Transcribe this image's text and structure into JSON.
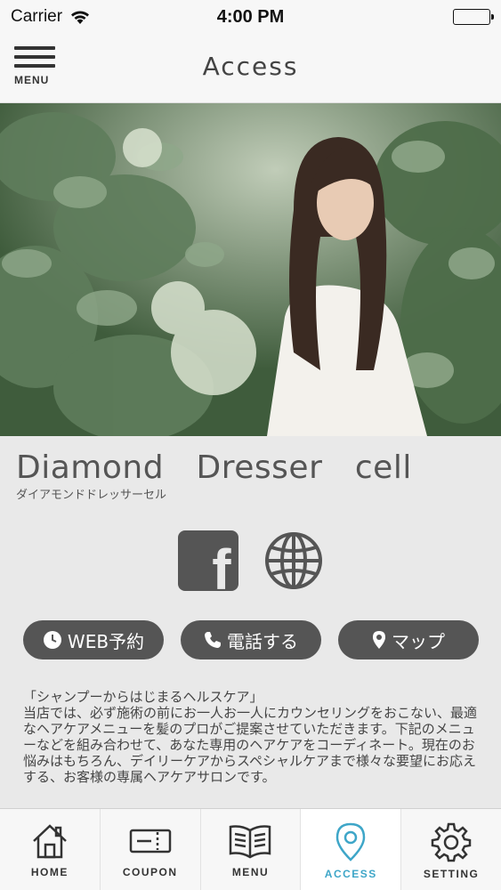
{
  "status_bar": {
    "carrier": "Carrier",
    "time": "4:00 PM"
  },
  "nav": {
    "menu_label": "MENU",
    "title": "Access"
  },
  "shop": {
    "name": "Diamond　Dresser　cell",
    "kana": "ダイアモンドドレッサーセル"
  },
  "actions": {
    "web_reserve": "WEB予約",
    "call": "電話する",
    "map": "マップ"
  },
  "description": "「シャンプーからはじまるヘルスケア」\n当店では、必ず施術の前にお一人お一人にカウンセリングをおこない、最適なヘアケアメニューを髪のプロがご提案させていただきます。下記のメニューなどを組み合わせて、あなた専用のヘアケアをコーディネート。現在のお悩みはもちろん、デイリーケアからスペシャルケアまで様々な要望にお応えする、お客様の専属ヘアケアサロンです。",
  "tabs": [
    {
      "label": "HOME",
      "icon": "home-icon"
    },
    {
      "label": "COUPON",
      "icon": "coupon-icon"
    },
    {
      "label": "MENU",
      "icon": "menu-book-icon"
    },
    {
      "label": "ACCESS",
      "icon": "location-pin-icon",
      "active": true
    },
    {
      "label": "SETTING",
      "icon": "gear-icon"
    }
  ],
  "colors": {
    "accent": "#3ea6c8",
    "button_bg": "#555555",
    "background": "#e9e9e9"
  }
}
